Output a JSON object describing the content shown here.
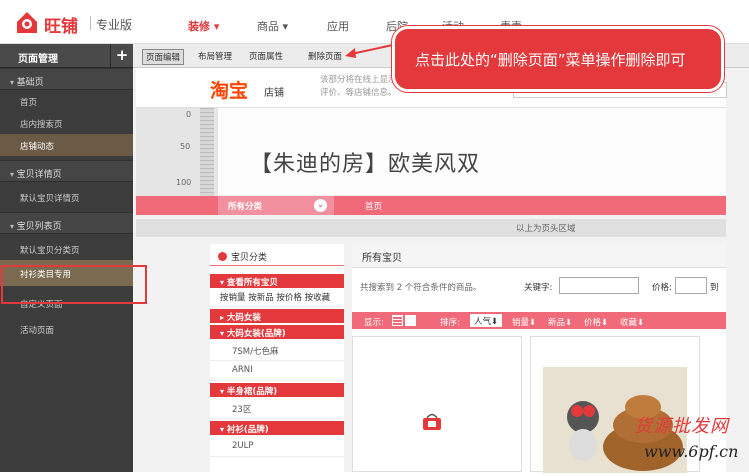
{
  "topbar": {
    "brand": "旺铺",
    "edition": "专业版",
    "nav": [
      {
        "label": "装修 ▾",
        "active": true
      },
      {
        "label": "商品 ▾",
        "active": false
      },
      {
        "label": "应用",
        "active": false
      },
      {
        "label": "后院",
        "active": false
      },
      {
        "label": "活动",
        "active": false
      },
      {
        "label": "素素",
        "active": false
      }
    ]
  },
  "sidebar": {
    "title": "页面管理",
    "add_label": "+",
    "groups": [
      {
        "label": "基础页",
        "items": [
          "首页",
          "店内搜索页",
          "店铺动态"
        ]
      },
      {
        "label": "宝贝详情页",
        "items": [
          "默认宝贝详情页"
        ]
      },
      {
        "label": "宝贝列表页",
        "items": [
          "默认宝贝分类页",
          "衬衫类目专用",
          "自定义页面",
          "活动页面"
        ]
      }
    ]
  },
  "tabs": [
    "页面编辑",
    "布局管理",
    "页面属性",
    "删除页面"
  ],
  "callout": "点击此处的“删除页面”菜单操作删除即可",
  "shop": {
    "logo": "淘宝",
    "logo_sub": "店铺",
    "desc": "该部分将在线上显示评价、等店铺信息。",
    "ruler": [
      "0",
      "50",
      "100"
    ],
    "banner_title": "【朱迪的房】欧美风双",
    "nav_all": "所有分类",
    "nav_home": "首页",
    "head_note": "以上为页头区域"
  },
  "categories": {
    "title": "宝贝分类",
    "sections": [
      {
        "head": "查看所有宝贝",
        "open": true,
        "sort_line": "按销量 按新品 按价格 按收藏",
        "items": []
      },
      {
        "head": "大码女装",
        "open": false,
        "items": []
      },
      {
        "head": "大码女装(品牌)",
        "open": true,
        "items": [
          "7SM/七色麻",
          "ARNI"
        ]
      },
      {
        "head": "半身裙(品牌)",
        "open": false,
        "items": [
          "23区"
        ]
      },
      {
        "head": "衬衫(品牌)",
        "open": true,
        "items": [
          "2ULP"
        ]
      }
    ]
  },
  "products": {
    "title": "所有宝贝",
    "result": "共搜索到 2 个符合条件的商品。",
    "keyword_label": "关键字:",
    "price_label": "价格:",
    "price_to": "到",
    "display_label": "显示:",
    "sort_label": "排序:",
    "sorts": [
      "人气⬇",
      "销量⬇",
      "新品⬇",
      "价格⬇",
      "收藏⬇"
    ]
  },
  "watermark": {
    "line1": "货源批发网",
    "line2": "www.6pf.cn"
  },
  "colors": {
    "brand_red": "#e4393c",
    "nav_pink": "#f06a7a",
    "sidebar": "#3c3c3c"
  }
}
